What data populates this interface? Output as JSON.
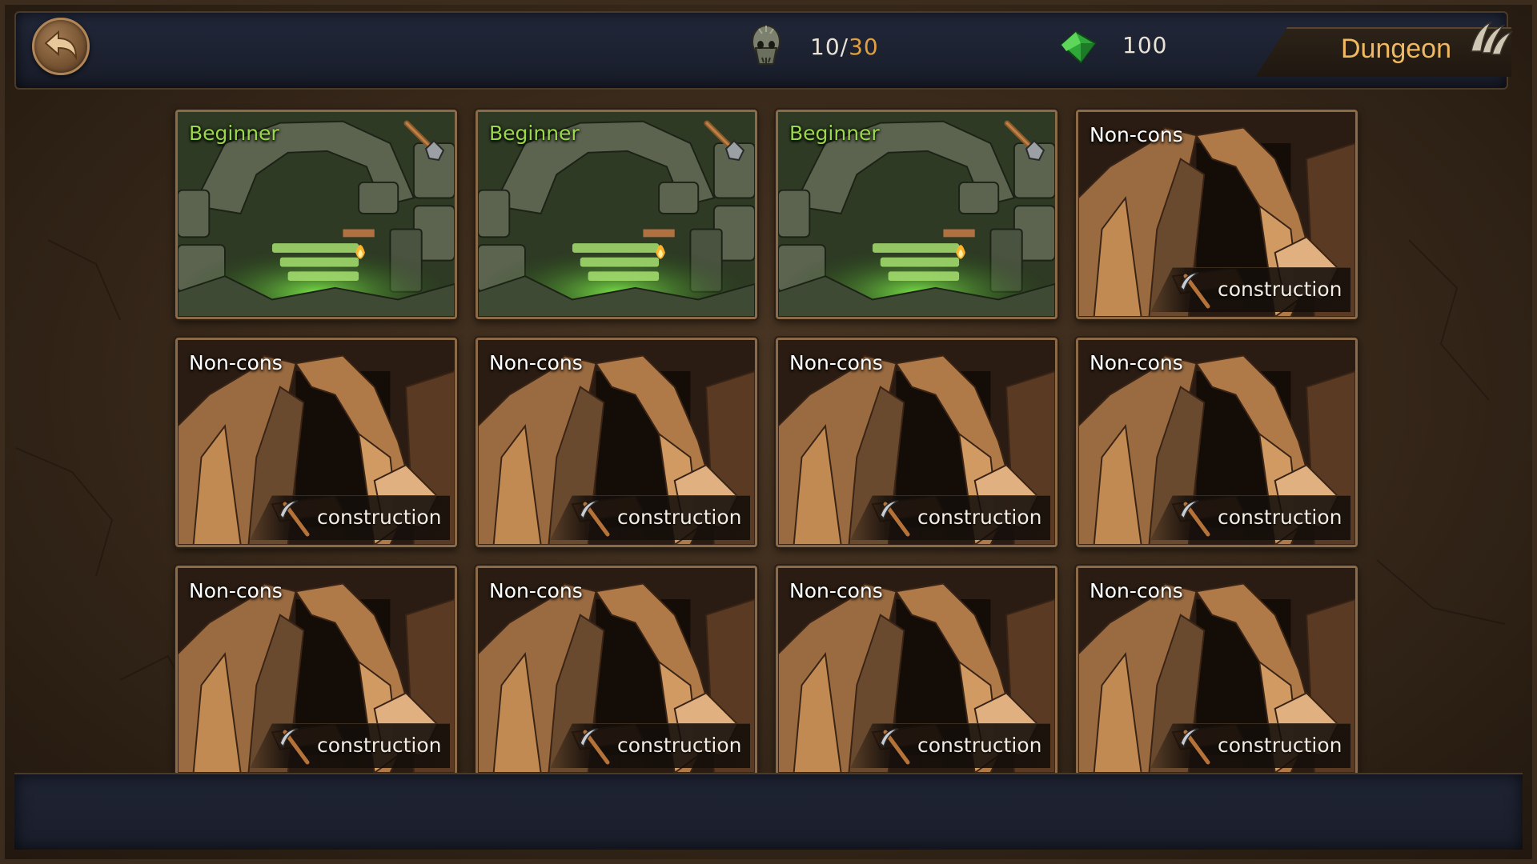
{
  "header": {
    "title": "Dungeon",
    "back_button": "back-arrow-icon",
    "monsters": {
      "current": "10",
      "separator": "/",
      "max": "30",
      "icon": "skull-icon"
    },
    "gems": {
      "value": "100",
      "icon": "green-gem-icon"
    },
    "title_icon": "claw-icon"
  },
  "slots": [
    {
      "type": "beginner",
      "label": "Beginner",
      "icon": "shovel-icon"
    },
    {
      "type": "beginner",
      "label": "Beginner",
      "icon": "shovel-icon"
    },
    {
      "type": "beginner",
      "label": "Beginner",
      "icon": "shovel-icon"
    },
    {
      "type": "locked",
      "label": "Non-cons",
      "action": "construction",
      "icon": "pickaxe-icon"
    },
    {
      "type": "locked",
      "label": "Non-cons",
      "action": "construction",
      "icon": "pickaxe-icon"
    },
    {
      "type": "locked",
      "label": "Non-cons",
      "action": "construction",
      "icon": "pickaxe-icon"
    },
    {
      "type": "locked",
      "label": "Non-cons",
      "action": "construction",
      "icon": "pickaxe-icon"
    },
    {
      "type": "locked",
      "label": "Non-cons",
      "action": "construction",
      "icon": "pickaxe-icon"
    },
    {
      "type": "locked",
      "label": "Non-cons",
      "action": "construction",
      "icon": "pickaxe-icon"
    },
    {
      "type": "locked",
      "label": "Non-cons",
      "action": "construction",
      "icon": "pickaxe-icon"
    },
    {
      "type": "locked",
      "label": "Non-cons",
      "action": "construction",
      "icon": "pickaxe-icon"
    },
    {
      "type": "locked",
      "label": "Non-cons",
      "action": "construction",
      "icon": "pickaxe-icon"
    }
  ],
  "colors": {
    "beginner_label": "#9bd84a",
    "title": "#f0b860",
    "max_count": "#e0a040"
  }
}
